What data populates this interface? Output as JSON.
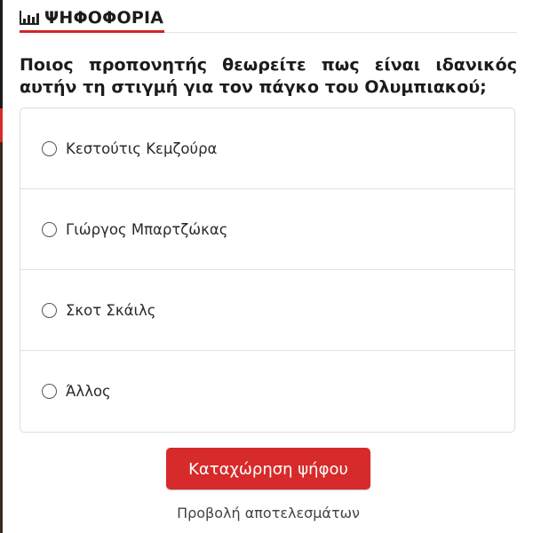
{
  "header": {
    "title": "ΨΗΦΟΦΟΡΙΑ",
    "icon": "bar-chart-icon",
    "accent_color": "#d32424"
  },
  "poll": {
    "question": "Ποιος προπονητής θεωρείτε πως είναι ιδανικός αυτήν τη στιγμή για τον πάγκο του Ολυμπιακού;",
    "options": [
      {
        "label": "Κεστούτις Κεμζούρα",
        "selected": false
      },
      {
        "label": "Γιώργος Μπαρτζώκας",
        "selected": false
      },
      {
        "label": "Σκοτ Σκάιλς",
        "selected": false
      },
      {
        "label": "Άλλος",
        "selected": false
      }
    ]
  },
  "actions": {
    "submit_label": "Καταχώρηση ψήφου",
    "submit_color": "#d72a2a",
    "results_label": "Προβολή αποτελεσμάτων"
  }
}
